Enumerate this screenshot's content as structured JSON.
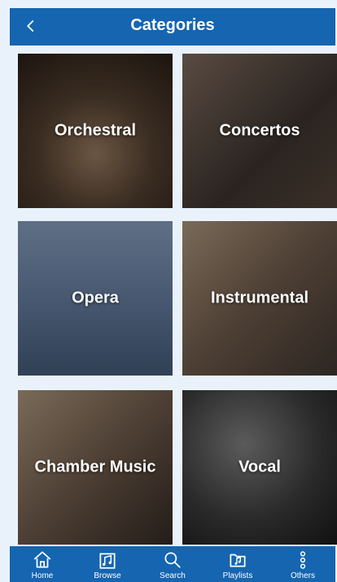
{
  "header": {
    "title": "Categories"
  },
  "categories": [
    {
      "label": "Orchestral"
    },
    {
      "label": "Concertos"
    },
    {
      "label": "Opera"
    },
    {
      "label": "Instrumental"
    },
    {
      "label": "Chamber Music"
    },
    {
      "label": "Vocal"
    }
  ],
  "tabs": [
    {
      "label": "Home",
      "icon": "home-icon"
    },
    {
      "label": "Browse",
      "icon": "browse-icon"
    },
    {
      "label": "Search",
      "icon": "search-icon"
    },
    {
      "label": "Playlists",
      "icon": "playlists-icon"
    },
    {
      "label": "Others",
      "icon": "more-icon"
    }
  ],
  "colors": {
    "header": "#1565b0",
    "background": "#e9f2fb",
    "tabbar": "#1565b0",
    "text": "#ffffff"
  }
}
